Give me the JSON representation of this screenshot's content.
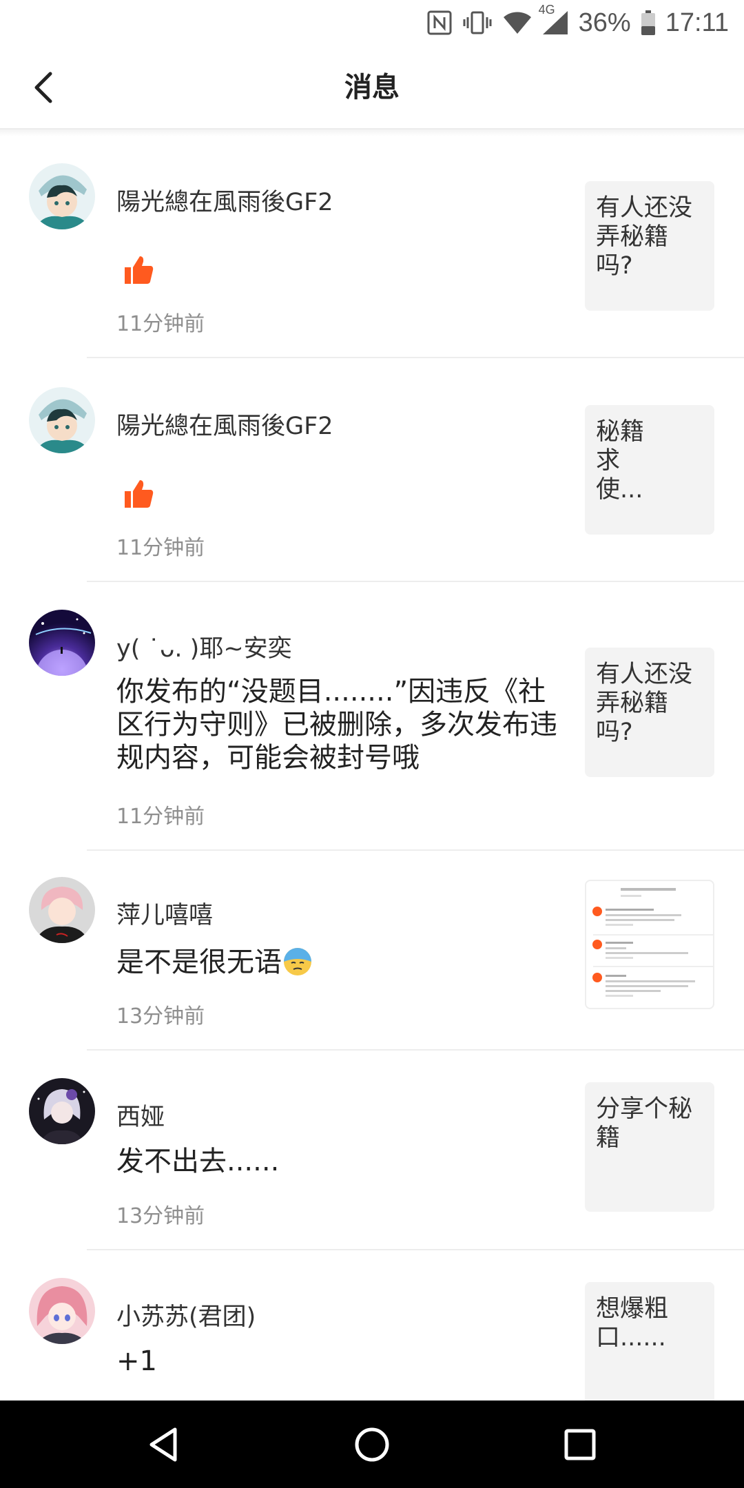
{
  "status": {
    "network": "4G",
    "battery": "36%",
    "time": "17:11"
  },
  "header": {
    "title": "消息"
  },
  "messages": [
    {
      "user": "陽光總在風雨後GF2",
      "type": "like",
      "time": "11分钟前",
      "thumb": "有人还没弄秘籍吗?",
      "avatar_icon": "anime-boy-avatar"
    },
    {
      "user": "陽光總在風雨後GF2",
      "type": "like",
      "time": "11分钟前",
      "thumb": "秘籍\n求\n使...",
      "avatar_icon": "anime-boy-avatar"
    },
    {
      "user": "y( ˙ᴗ. )耶~安奕",
      "content": "你发布的“没题目........”因违反《社区行为守则》已被删除，多次发布违规内容，可能会被封号哦",
      "time": "11分钟前",
      "thumb": "有人还没弄秘籍吗?",
      "avatar_icon": "galaxy-avatar"
    },
    {
      "user": "萍儿嘻嘻",
      "content": "是不是很无语",
      "emoji": "sweat-face-emoji",
      "time": "13分钟前",
      "thumb_type": "screenshot-thumbnail",
      "avatar_icon": "pink-hair-avatar"
    },
    {
      "user": "西娅",
      "content": "发不出去......",
      "time": "13分钟前",
      "thumb": "分享个秘籍",
      "avatar_icon": "dark-anime-avatar"
    },
    {
      "user": "小苏苏(君团)",
      "content": "+1",
      "thumb": "想爆粗口......",
      "avatar_icon": "pink-anime-avatar"
    }
  ],
  "colors": {
    "like": "#ff5a1f",
    "time": "#8e8e8e",
    "thumb_bg": "#f3f3f3",
    "divider": "#ededed"
  }
}
